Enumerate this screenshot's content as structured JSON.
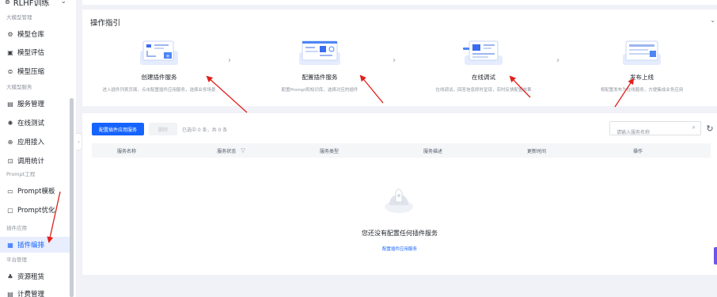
{
  "sidebar": {
    "top_label": "RLHF训练",
    "groups": [
      {
        "label": "大模型管理",
        "items": [
          {
            "label": "模型仓库",
            "icon": "model-repo-icon",
            "glyph": "⚙"
          },
          {
            "label": "模型评估",
            "icon": "evaluate-icon",
            "glyph": "▣"
          },
          {
            "label": "模型压缩",
            "icon": "compress-icon",
            "glyph": "⊜"
          }
        ]
      },
      {
        "label": "大模型服务",
        "items": [
          {
            "label": "服务管理",
            "icon": "service-manage-icon",
            "glyph": "▤"
          },
          {
            "label": "在线测试",
            "icon": "online-test-icon",
            "glyph": "✺"
          },
          {
            "label": "应用接入",
            "icon": "app-access-icon",
            "glyph": "⊕"
          },
          {
            "label": "调用统计",
            "icon": "stats-icon",
            "glyph": "⊡"
          }
        ]
      },
      {
        "label": "Prompt工程",
        "items": [
          {
            "label": "Prompt模板",
            "icon": "prompt-template-icon",
            "glyph": "▭"
          },
          {
            "label": "Prompt优化",
            "icon": "prompt-optimize-icon",
            "glyph": "▢"
          }
        ]
      },
      {
        "label": "插件应用",
        "items": [
          {
            "label": "插件编排",
            "icon": "plugin-orchestrate-icon",
            "glyph": "▦",
            "active": true
          }
        ]
      },
      {
        "label": "平台管理",
        "items": [
          {
            "label": "资源租赁",
            "icon": "resource-icon",
            "glyph": "♣"
          },
          {
            "label": "计费管理",
            "icon": "billing-icon",
            "glyph": "▤"
          }
        ]
      }
    ]
  },
  "guide": {
    "title": "操作指引",
    "steps": [
      {
        "name": "创建插件服务",
        "desc": "进入插件列表页面，点击配置插件应用服务，选择业务场景"
      },
      {
        "name": "配置插件服务",
        "desc": "配置Prompt和知识库，选择对应的插件"
      },
      {
        "name": "在线调试",
        "desc": "在线调试，回答信息即时呈现，实时反馈配置效果"
      },
      {
        "name": "发布上线",
        "desc": "将配置发布为在线服务，方便集成业务应用"
      }
    ]
  },
  "toolbar": {
    "primary_label": "配置插件应用服务",
    "delete_label": "删除",
    "selected_info": "已选中 0 条，共 0 条",
    "search_placeholder": "请输入服务名称"
  },
  "table": {
    "columns": [
      "服务名称",
      "服务状态",
      "服务类型",
      "服务描述",
      "更新时间",
      "操作"
    ]
  },
  "empty": {
    "message": "您还没有配置任何插件服务",
    "link": "配置插件应用服务"
  },
  "colors": {
    "accent": "#1664ff",
    "annotation": "#e0201b"
  }
}
